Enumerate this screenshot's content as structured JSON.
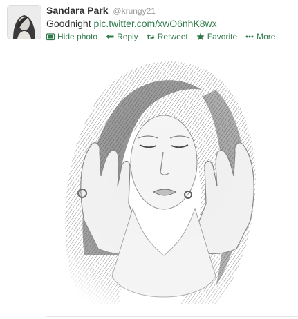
{
  "tweet": {
    "fullname": "Sandara Park",
    "username": "@krungy21",
    "text": "Goodnight",
    "link": "pic.twitter.com/xwO6nhK8wx",
    "actions": {
      "hide_photo": "Hide photo",
      "reply": "Reply",
      "retweet": "Retweet",
      "favorite": "Favorite",
      "more": "More"
    }
  },
  "colors": {
    "accent": "#2f7a4a",
    "text": "#333333",
    "muted": "#999999"
  },
  "icons": {
    "hide_photo": "photo-icon",
    "reply": "reply-arrow-icon",
    "retweet": "retweet-icon",
    "favorite": "star-icon",
    "more": "more-dots-icon"
  }
}
